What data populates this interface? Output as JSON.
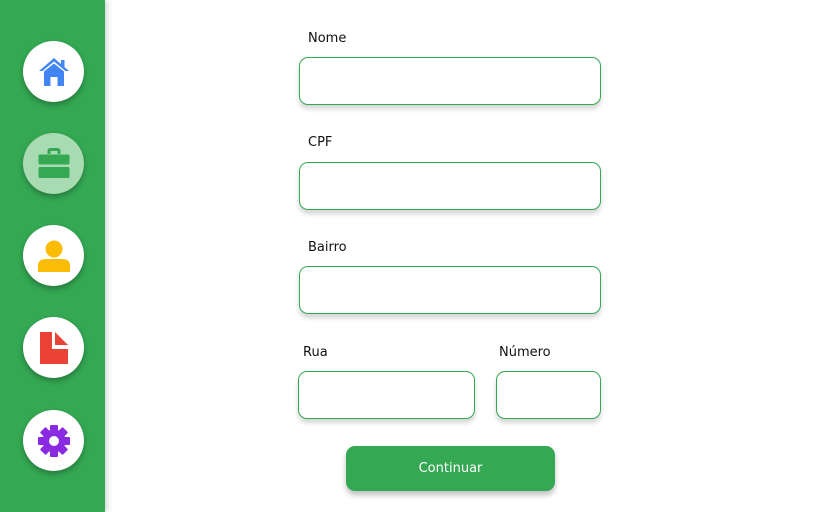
{
  "sidebar": {
    "background": "#34a853",
    "items": [
      {
        "icon": "home-icon",
        "color": "#4285f4",
        "active": false
      },
      {
        "icon": "briefcase-icon",
        "color": "#34a853",
        "active": true
      },
      {
        "icon": "user-icon",
        "color": "#fbbc05",
        "active": false
      },
      {
        "icon": "document-icon",
        "color": "#ea4335",
        "active": false
      },
      {
        "icon": "settings-icon",
        "color": "#8a2be2",
        "active": false
      }
    ]
  },
  "form": {
    "accent_color": "#34a853",
    "nome": {
      "label": "Nome",
      "value": ""
    },
    "cpf": {
      "label": "CPF",
      "value": ""
    },
    "bairro": {
      "label": "Bairro",
      "value": ""
    },
    "rua": {
      "label": "Rua",
      "value": ""
    },
    "numero": {
      "label": "Número",
      "value": ""
    },
    "continue_label": "Continuar"
  }
}
